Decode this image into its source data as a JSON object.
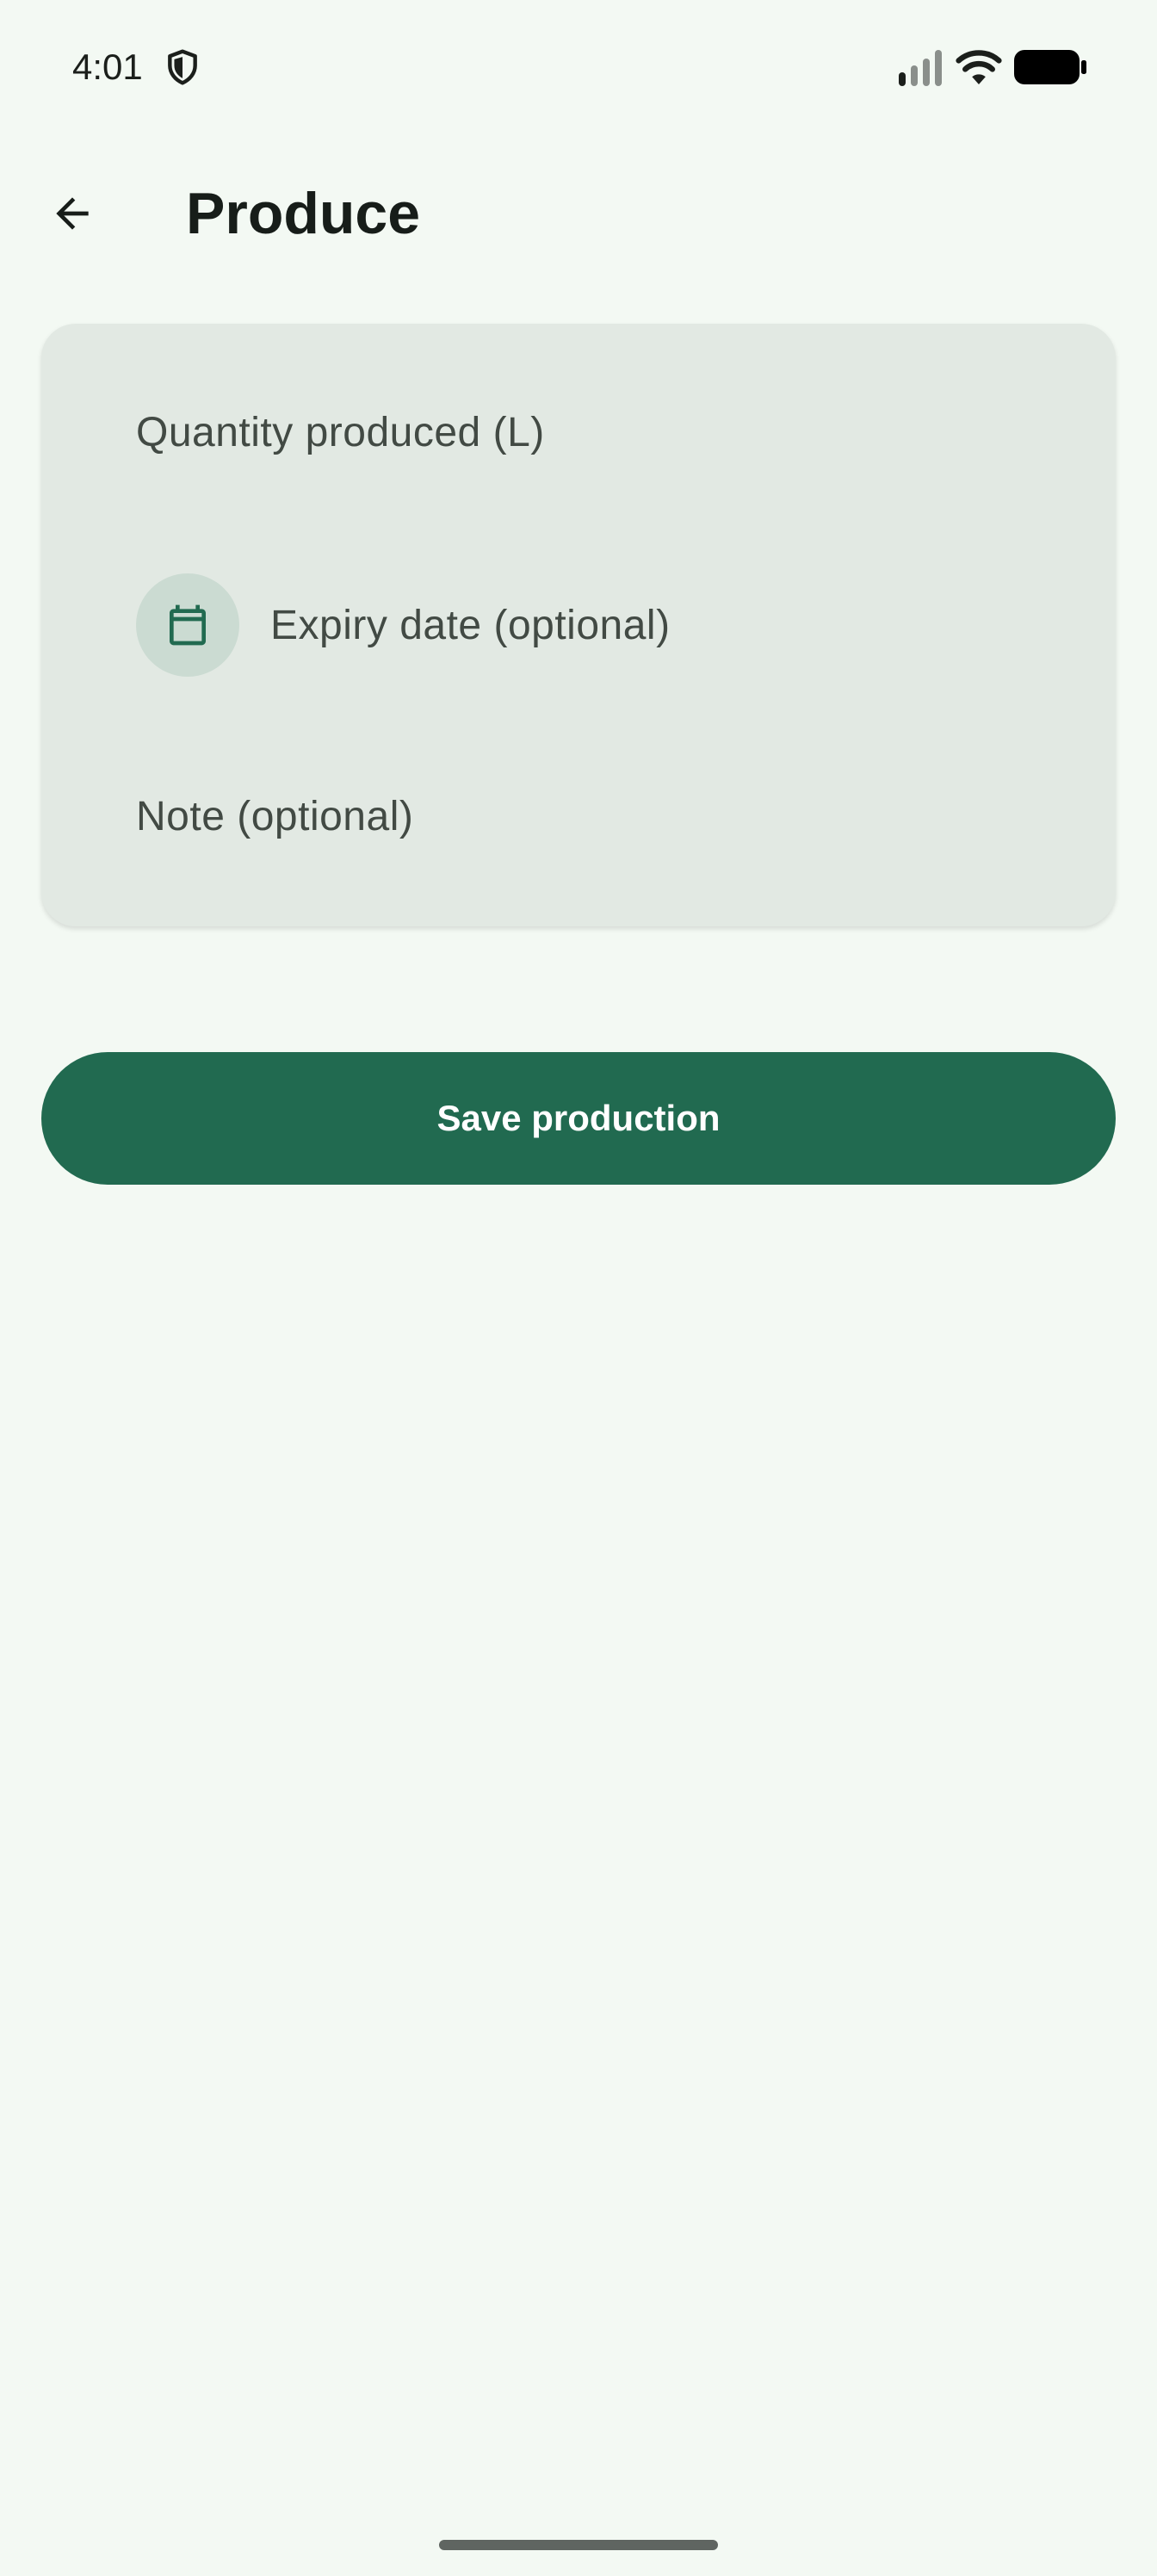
{
  "status_bar": {
    "time": "4:01",
    "icons": [
      "shield-icon",
      "signal-icon",
      "wifi-icon",
      "battery-icon"
    ]
  },
  "app_bar": {
    "back_icon": "arrow-back-icon",
    "title": "Produce"
  },
  "form": {
    "quantity": {
      "label": "Quantity produced (L)",
      "value": ""
    },
    "expiry": {
      "icon": "calendar-icon",
      "label": "Expiry date (optional)",
      "value": ""
    },
    "note": {
      "label": "Note (optional)",
      "value": ""
    }
  },
  "actions": {
    "save_label": "Save production"
  },
  "colors": {
    "background": "#f3f9f3",
    "card": "#e2e9e3",
    "primary": "#216a50",
    "calendar_bg": "#cbdbd2",
    "text_primary": "#171d19",
    "text_secondary": "#424a44"
  }
}
